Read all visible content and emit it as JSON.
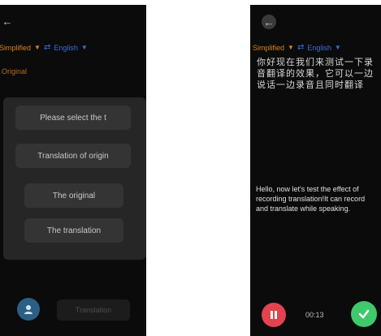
{
  "left_screen": {
    "source_language": "Simplified",
    "target_language": "English",
    "original_label": "Original",
    "menu": {
      "select_prompt": "Please select the t",
      "translation_of_original": "Translation of origin",
      "original": "The original",
      "translation": "The translation"
    },
    "translate_button": "Translation"
  },
  "right_screen": {
    "source_language": "Simplified",
    "target_language": "English",
    "source_text": "你好现在我们来测试一下录音翻译的效果，它可以一边说话一边录音且同时翻译",
    "translated_text": "Hello, now let's test the effect of recording translation!It can record and translate while speaking.",
    "timer": "00:13"
  },
  "colors": {
    "source_lang": "#d8821f",
    "target_lang": "#3a6fd8",
    "pause_button": "#e2434f",
    "confirm_button": "#3fc96b",
    "mic_button": "#2b5f85"
  }
}
